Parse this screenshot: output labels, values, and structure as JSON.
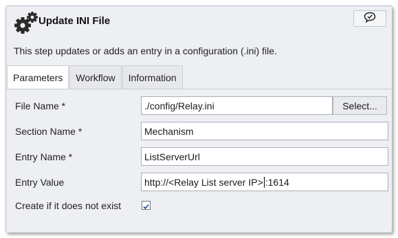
{
  "dialog": {
    "title": "Update INI File",
    "description": "This step updates or adds an entry in a configuration (.ini) file."
  },
  "tabs": [
    {
      "label": "Parameters",
      "active": true
    },
    {
      "label": "Workflow",
      "active": false
    },
    {
      "label": "Information",
      "active": false
    }
  ],
  "fields": {
    "file_name": {
      "label": "File Name *",
      "value": "./config/Relay.ini",
      "button": "Select..."
    },
    "section_name": {
      "label": "Section Name *",
      "value": "Mechanism"
    },
    "entry_name": {
      "label": "Entry Name *",
      "value": "ListServerUrl"
    },
    "entry_value": {
      "label": "Entry Value",
      "value_before_cursor": "http://<Relay List server IP>",
      "value_after_cursor": ":1614"
    },
    "create_if_missing": {
      "label": "Create if it does not exist",
      "checked": true
    }
  },
  "icons": {
    "header_icon": "gears-icon",
    "help_icon": "speech-bubble-icon"
  }
}
